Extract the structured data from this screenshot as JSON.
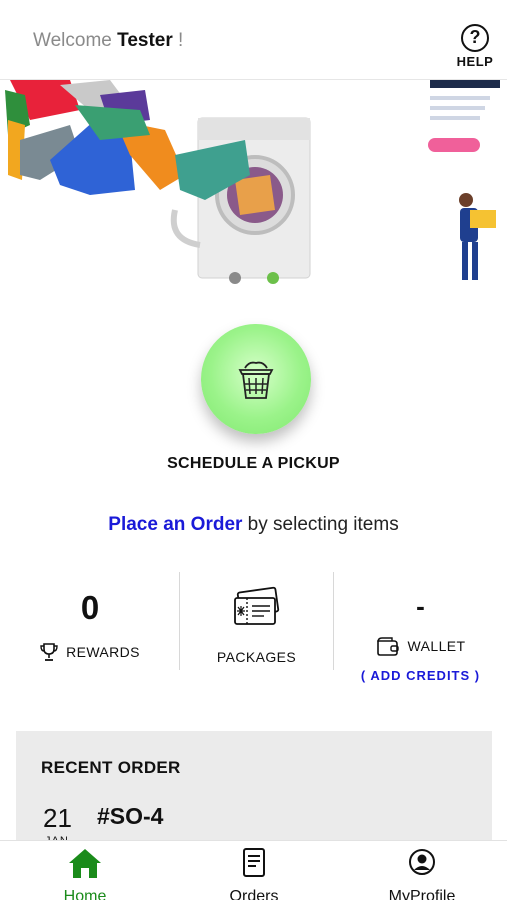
{
  "header": {
    "welcome": "Welcome",
    "user": "Tester",
    "exclaim": "!",
    "help_label": "HELP",
    "help_glyph": "?"
  },
  "banner": {
    "slides": 2,
    "active_slide": 2
  },
  "pickup": {
    "label": "SCHEDULE A PICKUP",
    "icon": "laundry-basket-icon"
  },
  "order_prompt": {
    "link": "Place an Order",
    "rest": " by selecting items"
  },
  "stats": {
    "rewards": {
      "value": "0",
      "label": "REWARDS",
      "icon": "trophy-icon"
    },
    "packages": {
      "label": "PACKAGES",
      "icon": "tickets-icon"
    },
    "wallet": {
      "value": "-",
      "label": "WALLET",
      "icon": "wallet-icon",
      "action": "( ADD CREDITS )"
    }
  },
  "recent_order": {
    "title": "RECENT ORDER",
    "day": "21",
    "month": "JAN",
    "id": "#SO-4"
  },
  "nav": {
    "items": [
      {
        "label": "Home",
        "icon": "home-icon",
        "active": true
      },
      {
        "label": "Orders",
        "icon": "document-icon"
      },
      {
        "label": "MyProfile",
        "icon": "profile-icon"
      }
    ]
  },
  "colors": {
    "accent_blue": "#1a1ad8",
    "active_green": "#1a8b1a",
    "pickup_green": "#9bf38a",
    "dot_active": "#6cc04a"
  }
}
